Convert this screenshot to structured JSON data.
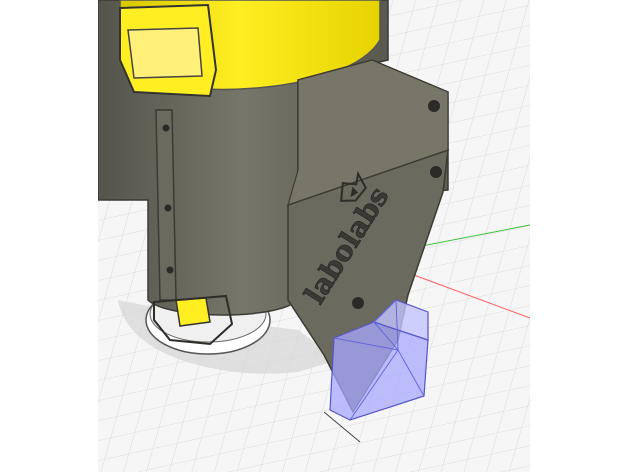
{
  "viewport": {
    "background": "#f6f6f6",
    "grid_color": "#d9d9d9",
    "axis_x_color": "#ff5a5a",
    "axis_y_color": "#3cc23c",
    "axis_z_color": "#5a78ff"
  },
  "model": {
    "body_color": "#6b6a5f",
    "body_shadow": "#4f4e45",
    "accent_color": "#ffee22",
    "ring_color": "#ffffff",
    "selected_part_color": "#a8a8ff",
    "engraving_text": "labolabs",
    "engraving_icon": "labolabs-bird-logo-icon"
  }
}
